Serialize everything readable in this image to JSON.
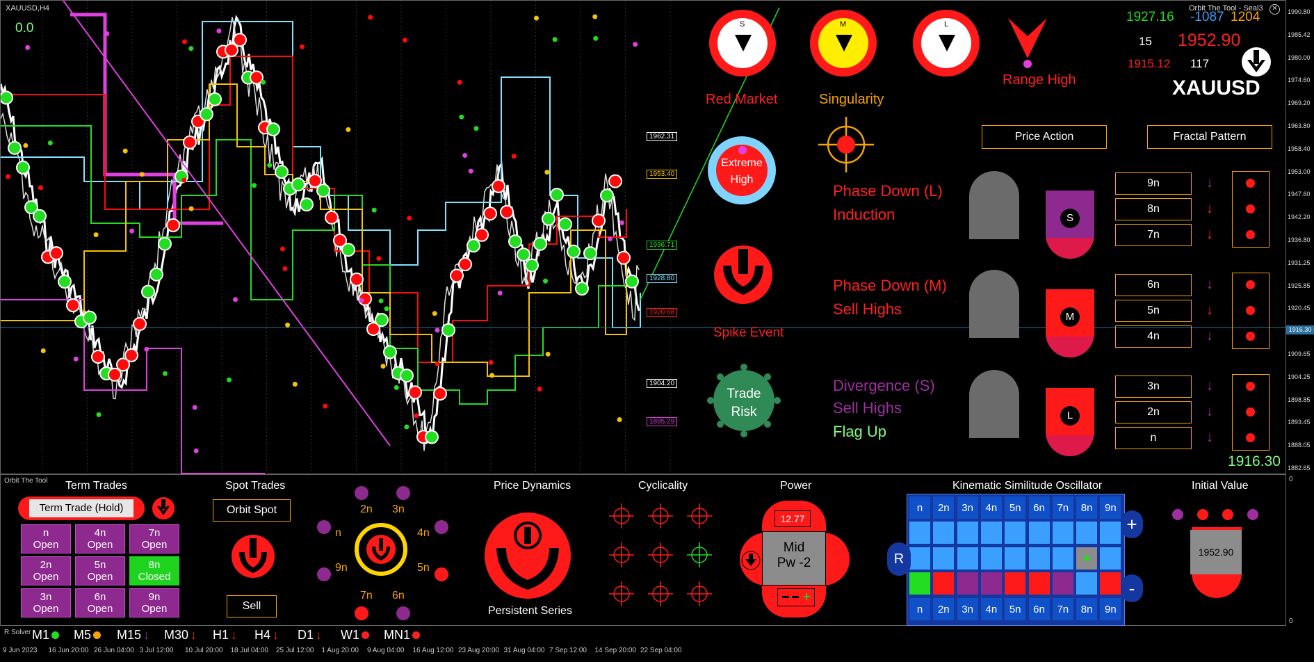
{
  "chart": {
    "symbol": "XAUUSD,H4",
    "top_value": "0.0",
    "indicator_title": "Orbit The Tool - Seal3",
    "price_axis": [
      "1990.80",
      "1985.42",
      "1980.00",
      "1974.60",
      "1969.20",
      "1963.80",
      "1958.40",
      "1953.00",
      "1947.60",
      "1942.20",
      "1936.80",
      "1931.25",
      "1925.85",
      "1920.45",
      "1915.05",
      "1909.65",
      "1904.25",
      "1898.85",
      "1893.45",
      "1888.05",
      "1882.65"
    ],
    "current_price_label": "1916.30",
    "level_tags": [
      {
        "text": "1962.31",
        "color": "#ffffff"
      },
      {
        "text": "1953.40",
        "color": "#f5c400"
      },
      {
        "text": "1936.71",
        "color": "#22dd22"
      },
      {
        "text": "1928.80",
        "color": "#7fe4ff"
      },
      {
        "text": "1920.88",
        "color": "#ff2020"
      },
      {
        "text": "1904.20",
        "color": "#ffffff"
      },
      {
        "text": "1895.29",
        "color": "#e040e0"
      }
    ],
    "sub_panel_title": "Orbit The Tool",
    "sub_axis_top": "0",
    "sub_axis_bottom": "0",
    "date_axis": [
      "9 Jun 2023",
      "16 Jun 20:00",
      "26 Jun 04:00",
      "3 Jul 12:00",
      "10 Jul 20:00",
      "18 Jul 04:00",
      "25 Jul 12:00",
      "1 Aug 20:00",
      "9 Aug 04:00",
      "16 Aug 12:00",
      "23 Aug 20:00",
      "31 Aug 04:00",
      "7 Sep 12:00",
      "14 Sep 20:00",
      "22 Sep 04:00"
    ],
    "colors": {
      "red": "#ff0a0a",
      "green": "#22dd22",
      "yellow": "#f5c400",
      "magenta": "#e040e0",
      "cyan": "#7fe4ff",
      "purple": "#9f2ea0"
    }
  },
  "dashboard": {
    "sml": [
      {
        "letter": "S"
      },
      {
        "letter": "M"
      },
      {
        "letter": "L"
      }
    ],
    "red_market": "Red Market",
    "singularity": "Singularity",
    "range_high": "Range High",
    "extreme_high": [
      "Extreme",
      "High"
    ],
    "spike_event": "Spike Event",
    "trade_risk": [
      "Trade",
      "Risk"
    ],
    "stats": {
      "v1": "1927.16",
      "v2": "-1087",
      "v3": "1204",
      "v4": "15",
      "v5": "1952.90",
      "v6": "1915.12",
      "v7": "117"
    },
    "symbol": "XAUUSD",
    "price_action": "Price Action",
    "fractal_pattern": "Fractal Pattern",
    "phases": [
      {
        "line1": "Phase Down (L)",
        "line2": "Induction",
        "c1": "#ff2020",
        "c2": "#ff2020",
        "badge": "S",
        "badge_bg": "#8e2a8f"
      },
      {
        "line1": "Phase Down (M)",
        "line2": "Sell Highs",
        "c1": "#ff2020",
        "c2": "#ff2020",
        "badge": "M",
        "badge_bg": "#ff1a1a"
      },
      {
        "line1": "Divergence (S)",
        "line2": "Sell Highs",
        "line3": "Flag Up",
        "c1": "#9f2ea0",
        "c2": "#9f2ea0",
        "c3": "#7dff7d",
        "badge": "L",
        "badge_bg": "#ff1a1a"
      }
    ],
    "fractals": [
      [
        "9n",
        "8n",
        "7n"
      ],
      [
        "6n",
        "5n",
        "4n"
      ],
      [
        "3n",
        "2n",
        "n"
      ]
    ],
    "fractal_arrows": [
      [
        "#9f2ea0",
        "#ff2020",
        "#ff2020"
      ],
      [
        "#9f2ea0",
        "#ff2020",
        "#9f2ea0"
      ],
      [
        "#9f2ea0",
        "#9f2ea0",
        "#9f2ea0"
      ]
    ],
    "last_price": "1916.30"
  },
  "bottom": {
    "term_trades": {
      "title": "Term Trades",
      "button": "Term Trade (Hold)",
      "grid": [
        [
          {
            "n": "n",
            "s": "Open"
          },
          {
            "n": "4n",
            "s": "Open"
          },
          {
            "n": "7n",
            "s": "Open"
          }
        ],
        [
          {
            "n": "2n",
            "s": "Open"
          },
          {
            "n": "5n",
            "s": "Open"
          },
          {
            "n": "8n",
            "s": "Closed"
          }
        ],
        [
          {
            "n": "3n",
            "s": "Open"
          },
          {
            "n": "6n",
            "s": "Open"
          },
          {
            "n": "9n",
            "s": "Open"
          }
        ]
      ]
    },
    "spot_trades": {
      "title": "Spot Trades",
      "orbit_spot": "Orbit Spot",
      "sell": "Sell"
    },
    "orbit_labels": {
      "n": "n",
      "2n": "2n",
      "3n": "3n",
      "4n": "4n",
      "5n": "5n",
      "6n": "6n",
      "7n": "7n",
      "9n": "9n"
    },
    "price_dynamics": {
      "title": "Price Dynamics",
      "footer": "Persistent Series"
    },
    "cyclicality": {
      "title": "Cyclicality"
    },
    "power": {
      "title": "Power",
      "value": "12.77",
      "state": "Mid",
      "pw": "Pw -2"
    },
    "kso": {
      "title": "Kinematic Similitude Oscillator",
      "headers": [
        "n",
        "2n",
        "3n",
        "4n",
        "5n",
        "6n",
        "7n",
        "8n",
        "9n"
      ],
      "r_label": "R",
      "plus": "+",
      "minus": "-",
      "row3_colors": [
        "#22dd22",
        "#ff1a1a",
        "#8e2a8f",
        "#8e2a8f",
        "#ff1a1a",
        "#ff1a1a",
        "#8e2a8f",
        "#3a9fff",
        "#ff1a1a"
      ]
    },
    "initial_value": {
      "title": "Initial Value",
      "value": "1952.90"
    },
    "timeframes": [
      {
        "label": "M1",
        "color": "#22dd22",
        "kind": "dot"
      },
      {
        "label": "M5",
        "color": "#f5a300",
        "kind": "dot"
      },
      {
        "label": "M15",
        "color": "#9f2ea0",
        "kind": "arrow"
      },
      {
        "label": "M30",
        "color": "#ff2020",
        "kind": "arrow"
      },
      {
        "label": "H1",
        "color": "#ff2020",
        "kind": "arrow"
      },
      {
        "label": "H4",
        "color": "#ff2020",
        "kind": "arrow"
      },
      {
        "label": "D1",
        "color": "#ff2020",
        "kind": "arrow"
      },
      {
        "label": "W1",
        "color": "#ff2020",
        "kind": "dot"
      },
      {
        "label": "MN1",
        "color": "#ff2020",
        "kind": "dot"
      }
    ],
    "solver_label": "R Solver"
  }
}
